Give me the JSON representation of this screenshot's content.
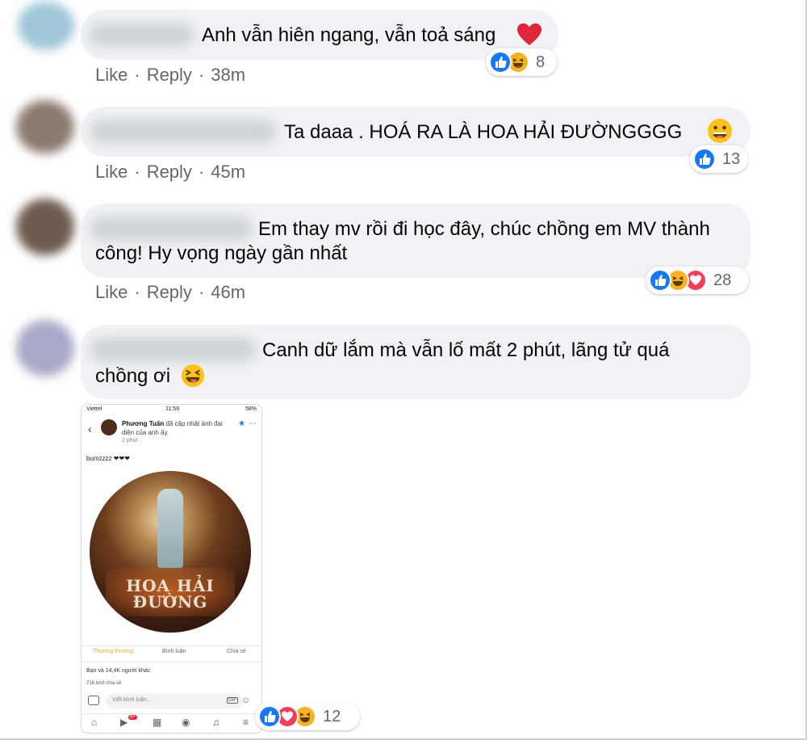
{
  "comments": [
    {
      "text_lines": [
        "Anh vẫn hiên ngang, vẫn toả sáng"
      ],
      "trailing_emoji": "red-heart",
      "like_label": "Like",
      "reply_label": "Reply",
      "time": "38m",
      "reactions": [
        "like",
        "haha"
      ],
      "reaction_count": "8"
    },
    {
      "text_lines": [
        "Ta daaa . HOÁ RA LÀ HOA HẢI ĐƯỜNGGGG"
      ],
      "trailing_emoji": "grinning-tongue",
      "like_label": "Like",
      "reply_label": "Reply",
      "time": "45m",
      "reactions": [
        "like"
      ],
      "reaction_count": "13"
    },
    {
      "text_lines": [
        "Em thay mv rồi đi học đây, chúc chồng em MV thành",
        "công! Hy vọng ngày gần nhất"
      ],
      "like_label": "Like",
      "reply_label": "Reply",
      "time": "46m",
      "reactions": [
        "like",
        "haha",
        "love"
      ],
      "reaction_count": "28"
    },
    {
      "text_lines": [
        "Canh dữ lắm mà vẫn lố mất 2 phút, lãng tử quá",
        "chồng ơi"
      ],
      "trailing_emoji": "squinting-tongue",
      "reactions": [
        "like",
        "love",
        "haha"
      ],
      "reaction_count": "12"
    }
  ],
  "attachment": {
    "status_left": "Viettel",
    "status_time": "11:59",
    "status_right": "58%",
    "poster_name": "Phương Tuấn",
    "post_action": "đã cập nhật ảnh đại diện của anh ấy.",
    "post_time": "2 phút ·",
    "caption": "bumzzzz ❤❤❤",
    "art_title_line1": "HOA HẢI",
    "art_title_line2": "ĐƯỜNG",
    "action_react": "Thương thương",
    "action_comment": "Bình luận",
    "action_share": "Chia sẻ",
    "likes_summary": "Bạn và 14,4K người khác",
    "shares_summary": "716 lượt chia sẻ",
    "input_placeholder": "Viết bình luận...",
    "gif_label": "GIF",
    "nav_badge": "9+"
  }
}
